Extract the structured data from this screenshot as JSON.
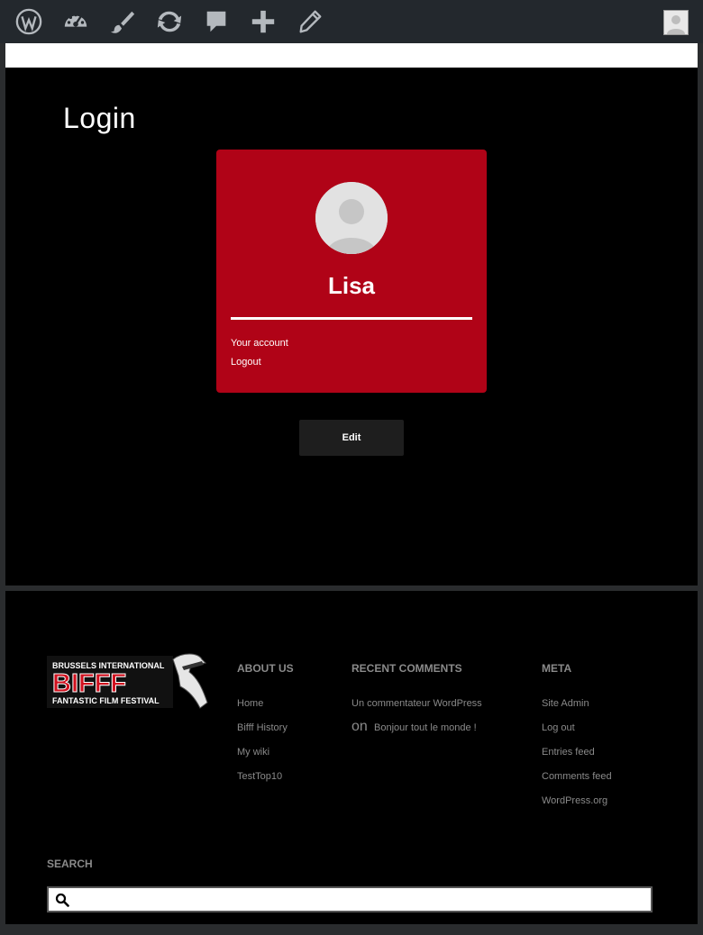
{
  "admin_bar": {
    "icons": [
      "wordpress-logo-icon",
      "dashboard-icon",
      "customize-brush-icon",
      "updates-icon",
      "comments-icon",
      "new-content-plus-icon",
      "edit-pencil-icon"
    ],
    "avatar": "user-avatar"
  },
  "main": {
    "title": "Login",
    "card": {
      "username": "Lisa",
      "links": [
        "Your account",
        "Logout"
      ],
      "background_color": "#b00317"
    },
    "edit_label": "Edit"
  },
  "footer": {
    "logo": {
      "line1": "BRUSSELS INTERNATIONAL",
      "line2": "BIFFF",
      "line3": "FANTASTIC FILM FESTIVAL"
    },
    "about": {
      "title": "ABOUT US",
      "links": [
        "Home",
        "Bifff History",
        "My wiki",
        "TestTop10"
      ]
    },
    "recent_comments": {
      "title": "RECENT COMMENTS",
      "author": "Un commentateur WordPress",
      "on": "on",
      "post": "Bonjour tout le monde !"
    },
    "meta": {
      "title": "META",
      "links": [
        "Site Admin",
        "Log out",
        "Entries feed",
        "Comments feed",
        "WordPress.org"
      ]
    },
    "search": {
      "title": "SEARCH",
      "placeholder": ""
    }
  }
}
